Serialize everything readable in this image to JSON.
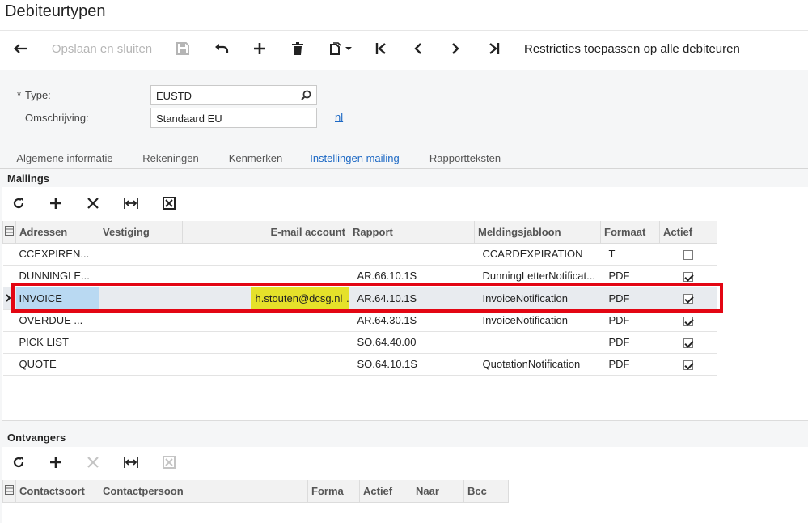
{
  "page": {
    "title": "Debiteurtypen"
  },
  "toolbar": {
    "save_close_label": "Opslaan en sluiten",
    "restrict_label": "Restricties toepassen op alle debiteuren"
  },
  "form": {
    "type_label": "Type:",
    "type_required": "*",
    "type_value": "EUSTD",
    "desc_label": "Omschrijving:",
    "desc_value": "Standaard EU",
    "lang_link": "nl"
  },
  "tabs": [
    "Algemene informatie",
    "Rekeningen",
    "Kenmerken",
    "Instellingen mailing",
    "Rapportteksten"
  ],
  "mailings": {
    "title": "Mailings",
    "columns": [
      "Adressen",
      "Vestiging",
      "E-mail account",
      "Rapport",
      "Meldingsjabloon",
      "Formaat",
      "Actief"
    ],
    "rows": [
      {
        "adres": "CCEXPIREN...",
        "vestiging": "",
        "email": "",
        "rapport": "",
        "sjabloon": "CCARDEXPIRATION",
        "formaat": "T",
        "actief": false
      },
      {
        "adres": "DUNNINGLE...",
        "vestiging": "",
        "email": "",
        "rapport": "AR.66.10.1S",
        "sjabloon": "DunningLetterNotificat...",
        "formaat": "PDF",
        "actief": true
      },
      {
        "adres": "INVOICE",
        "vestiging": "",
        "email": "h.stouten@dcsg.nl",
        "rapport": "AR.64.10.1S",
        "sjabloon": "InvoiceNotification",
        "formaat": "PDF",
        "actief": true
      },
      {
        "adres": "OVERDUE ...",
        "vestiging": "",
        "email": "",
        "rapport": "AR.64.30.1S",
        "sjabloon": "InvoiceNotification",
        "formaat": "PDF",
        "actief": true
      },
      {
        "adres": "PICK LIST",
        "vestiging": "",
        "email": "",
        "rapport": "SO.64.40.00",
        "sjabloon": "",
        "formaat": "PDF",
        "actief": true
      },
      {
        "adres": "QUOTE",
        "vestiging": "",
        "email": "",
        "rapport": "SO.64.10.1S",
        "sjabloon": "QuotationNotification",
        "formaat": "PDF",
        "actief": true
      }
    ]
  },
  "recipients": {
    "title": "Ontvangers",
    "columns": [
      "Contactsoort",
      "Contactpersoon",
      "Forma",
      "Actief",
      "Naar",
      "Bcc"
    ]
  }
}
